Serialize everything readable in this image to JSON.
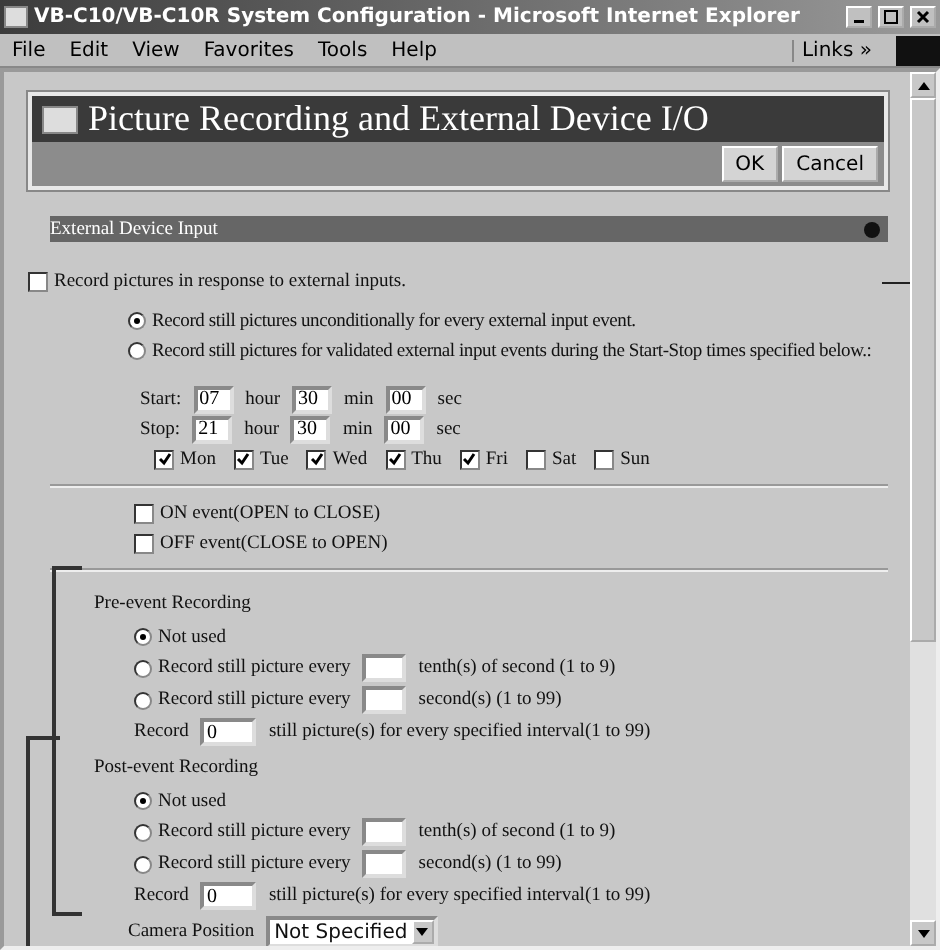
{
  "window": {
    "title": "VB-C10/VB-C10R System Configuration - Microsoft Internet Explorer"
  },
  "menu": [
    "File",
    "Edit",
    "View",
    "Favorites",
    "Tools",
    "Help"
  ],
  "links": {
    "label": "Links",
    "chevron": "»"
  },
  "page": {
    "title": "Picture Recording and External Device I/O",
    "buttons": [
      "OK",
      "Cancel"
    ]
  },
  "section": {
    "title": "External Device Input"
  },
  "record_on_input": {
    "label": "Record pictures in response to external inputs.",
    "checked": false
  },
  "modes": [
    {
      "label": "Record still pictures unconditionally for every external input event.",
      "selected": true
    },
    {
      "label": "Record still pictures for validated external input events during the Start-Stop times specified below.:",
      "selected": false
    }
  ],
  "schedule": [
    {
      "label": "Start:",
      "fields": [
        {
          "value": "07",
          "unit": "hour"
        },
        {
          "value": "30",
          "unit": "min"
        },
        {
          "value": "00",
          "unit": "sec"
        }
      ]
    },
    {
      "label": "Stop:",
      "fields": [
        {
          "value": "21",
          "unit": "hour"
        },
        {
          "value": "30",
          "unit": "min"
        },
        {
          "value": "00",
          "unit": "sec"
        }
      ]
    }
  ],
  "days": [
    {
      "label": "Mon",
      "checked": true
    },
    {
      "label": "Tue",
      "checked": true
    },
    {
      "label": "Wed",
      "checked": true
    },
    {
      "label": "Thu",
      "checked": true
    },
    {
      "label": "Fri",
      "checked": true
    },
    {
      "label": "Sat",
      "checked": false
    },
    {
      "label": "Sun",
      "checked": false
    }
  ],
  "events": [
    {
      "label": "ON event(OPEN to CLOSE)",
      "checked": false
    },
    {
      "label": "OFF event(CLOSE to OPEN)",
      "checked": false
    }
  ],
  "recordings": [
    {
      "title": "Pre-event Recording",
      "options": [
        {
          "kind": "plain",
          "label": "Not used",
          "selected": true
        },
        {
          "kind": "field",
          "before": "Record still picture every",
          "after": "tenth(s) of second (1 to 9)",
          "selected": false
        },
        {
          "kind": "field",
          "before": "Record still picture every",
          "after": "second(s) (1 to 99)",
          "selected": false
        }
      ],
      "count": {
        "before": "Record",
        "value": "0",
        "after": "still picture(s) for every specified interval(1 to 99)"
      }
    },
    {
      "title": "Post-event Recording",
      "options": [
        {
          "kind": "plain",
          "label": "Not used",
          "selected": true
        },
        {
          "kind": "field",
          "before": "Record still picture every",
          "after": "tenth(s) of second (1 to 9)",
          "selected": false
        },
        {
          "kind": "field",
          "before": "Record still picture every",
          "after": "second(s) (1 to 99)",
          "selected": false
        }
      ],
      "count": {
        "before": "Record",
        "value": "0",
        "after": "still picture(s) for every specified interval(1 to 99)"
      }
    }
  ],
  "camera_position": {
    "label": "Camera Position",
    "value": "Not Specified"
  }
}
